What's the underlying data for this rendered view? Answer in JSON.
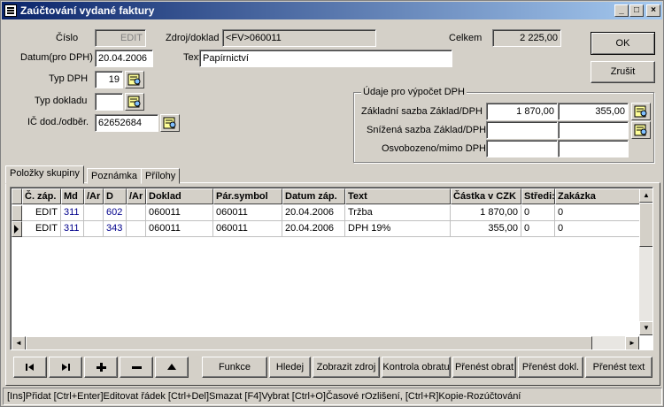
{
  "window": {
    "title": "Zaúčtování vydané faktury"
  },
  "form": {
    "cislo_label": "Číslo",
    "cislo_value": "EDIT",
    "zdroj_label": "Zdroj/doklad",
    "zdroj_value": "<FV>060011",
    "celkem_label": "Celkem",
    "celkem_value": "2 225,00",
    "datum_label": "Datum(pro DPH)",
    "datum_value": "20.04.2006",
    "text_label": "Text",
    "text_value": "Papírnictví",
    "typ_dph_label": "Typ DPH",
    "typ_dph_value": "19",
    "typ_dokladu_label": "Typ dokladu",
    "typ_dokladu_value": "",
    "ic_label": "IČ dod./odběr.",
    "ic_value": "62652684"
  },
  "buttons": {
    "ok": "OK",
    "cancel": "Zrušit"
  },
  "dph": {
    "title": "Údaje pro výpočet DPH",
    "zakladni_label": "Základní sazba  Základ/DPH",
    "zakladni_zaklad": "1 870,00",
    "zakladni_dph": "355,00",
    "snizena_label": "Snížená sazba Základ/DPH",
    "snizena_zaklad": "",
    "snizena_dph": "",
    "osvobozeno_label": "Osvobozeno/mimo DPH",
    "osvobozeno_zaklad": "",
    "osvobozeno_dph": ""
  },
  "tabs": [
    "Položky skupiny",
    "Poznámka",
    "Přílohy"
  ],
  "grid": {
    "columns": [
      "Č. záp.",
      "Md",
      "/Ar",
      "D",
      "/Ar",
      "Doklad",
      "Pár.symbol",
      "Datum záp.",
      "Text",
      "Částka v CZK",
      "Středi:",
      "Zakázka"
    ],
    "rows": [
      {
        "czap": "EDIT",
        "md": "311",
        "ar1": "",
        "d": "602",
        "ar2": "",
        "doklad": "060011",
        "par": "060011",
        "datum": "20.04.2006",
        "text": "Tržba",
        "castka": "1 870,00",
        "stredisko": "0",
        "zakazka": "0"
      },
      {
        "czap": "EDIT",
        "md": "311",
        "ar1": "",
        "d": "343",
        "ar2": "",
        "doklad": "060011",
        "par": "060011",
        "datum": "20.04.2006",
        "text": "DPH 19%",
        "castka": "355,00",
        "stredisko": "0",
        "zakazka": "0"
      }
    ]
  },
  "toolbar": {
    "funkce": "Funkce",
    "hledej": "Hledej",
    "zobrazit": "Zobrazit zdroj",
    "kontrola": "Kontrola obratu",
    "prenest_obrat": "Přenést obrat",
    "prenest_dokl": "Přenést dokl.",
    "prenest_text": "Přenést text"
  },
  "status": "[Ins]Přidat [Ctrl+Enter]Editovat řádek [Ctrl+Del]Smazat [F4]Vybrat [Ctrl+O]Časové rOzlišení, [Ctrl+R]Kopie-Rozúčtování"
}
